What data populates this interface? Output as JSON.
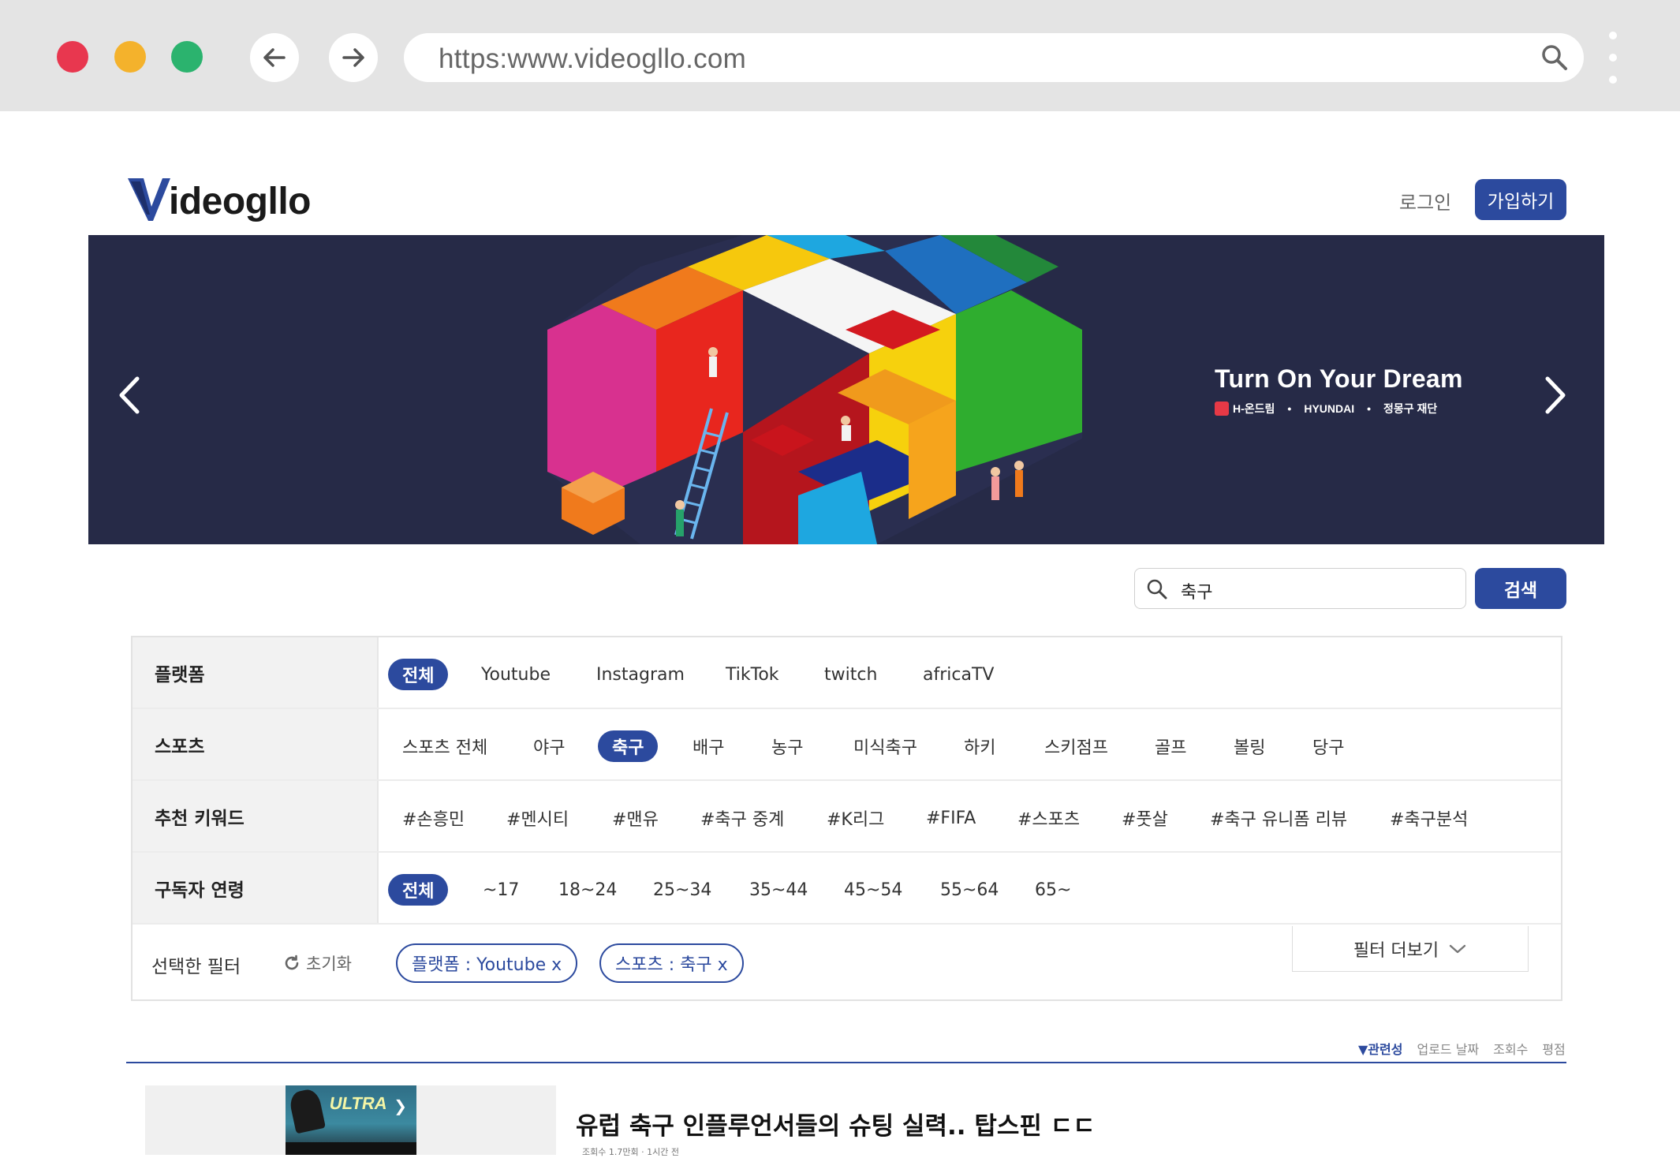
{
  "browser": {
    "url": "https:www.videogllo.com"
  },
  "header": {
    "logo_text": "ideogllo",
    "login_label": "로그인",
    "signup_label": "가입하기"
  },
  "banner": {
    "tagline": "Turn On Your Dream",
    "sponsors": [
      "H-온드림",
      "HYUNDAI",
      "정몽구 재단"
    ]
  },
  "search": {
    "value": "축구",
    "button_label": "검색"
  },
  "filters": {
    "platform": {
      "label": "플랫폼",
      "options": [
        "전체",
        "Youtube",
        "Instagram",
        "TikTok",
        "twitch",
        "africaTV"
      ],
      "active": "전체"
    },
    "sports": {
      "label": "스포츠",
      "options": [
        "스포츠 전체",
        "야구",
        "축구",
        "배구",
        "농구",
        "미식축구",
        "하키",
        "스키점프",
        "골프",
        "볼링",
        "당구"
      ],
      "active": "축구"
    },
    "keywords": {
      "label": "추천 키워드",
      "options": [
        "#손흥민",
        "#멘시티",
        "#맨유",
        "#축구 중계",
        "#K리그",
        "#FIFA",
        "#스포츠",
        "#풋살",
        "#축구 유니폼 리뷰",
        "#축구분석"
      ]
    },
    "age": {
      "label": "구독자 연령",
      "options": [
        "전체",
        "~17",
        "18~24",
        "25~34",
        "35~44",
        "45~54",
        "55~64",
        "65~"
      ],
      "active": "전체"
    },
    "selected": {
      "label": "선택한 필터",
      "reset_label": "초기화",
      "pills": [
        "플랫폼 : Youtube  x",
        "스포츠 : 축구  x"
      ],
      "more_label": "필터 더보기"
    }
  },
  "sort": {
    "options": [
      "▼관련성",
      "업로드 날짜",
      "조회수",
      "평점"
    ],
    "active": "▼관련성"
  },
  "results": [
    {
      "title": "유럽 축구 인플루언서들의 슈팅 실력.. 탑스핀 ㄷㄷ",
      "meta": "조회수 1.7만회 · 1시간 전",
      "thumb_text": "ULTRA"
    }
  ],
  "colors": {
    "primary": "#2c4a9e",
    "banner_bg": "#262a47",
    "chrome_bg": "#e4e4e4"
  }
}
